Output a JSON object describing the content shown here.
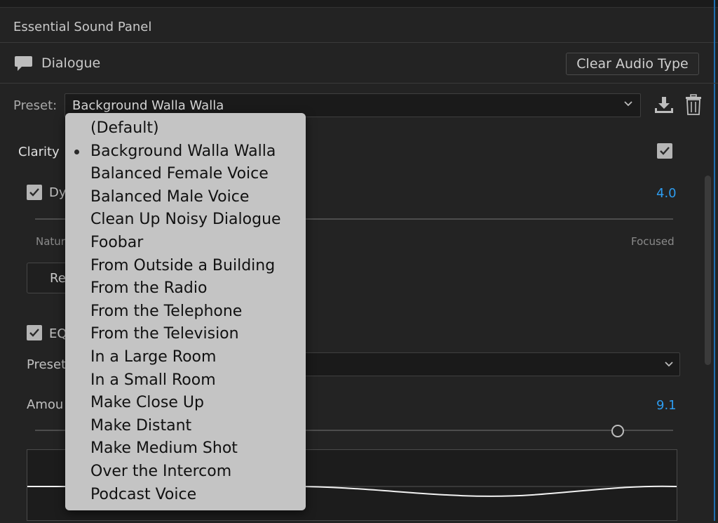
{
  "panel": {
    "title": "Essential Sound Panel"
  },
  "audio_type": {
    "label": "Dialogue",
    "clear_button": "Clear Audio Type",
    "icon": "speech-bubble-icon"
  },
  "preset": {
    "label": "Preset:",
    "selected": "Background Walla Walla"
  },
  "clarity": {
    "label": "Clarity",
    "enabled": true
  },
  "dynamics": {
    "label_partial": "Dy",
    "checked": true,
    "value": "4.0",
    "left_label_partial": "Natur",
    "right_label": "Focused",
    "reset_partial": "Re"
  },
  "eq": {
    "label_partial": "EQ",
    "checked": true,
    "preset_label_partial": "Preset",
    "amount_label_partial": "Amou",
    "amount_value": "9.1",
    "amount_fraction": 0.91
  },
  "dropdown": {
    "items": [
      {
        "label": "(Default)",
        "selected": false
      },
      {
        "label": "Background Walla Walla",
        "selected": true
      },
      {
        "label": "Balanced Female Voice",
        "selected": false
      },
      {
        "label": "Balanced Male Voice",
        "selected": false
      },
      {
        "label": "Clean Up Noisy Dialogue",
        "selected": false
      },
      {
        "label": "Foobar",
        "selected": false
      },
      {
        "label": "From Outside a Building",
        "selected": false
      },
      {
        "label": "From the Radio",
        "selected": false
      },
      {
        "label": "From the Telephone",
        "selected": false
      },
      {
        "label": "From the Television",
        "selected": false
      },
      {
        "label": "In a Large Room",
        "selected": false
      },
      {
        "label": "In a Small Room",
        "selected": false
      },
      {
        "label": "Make Close Up",
        "selected": false
      },
      {
        "label": "Make Distant",
        "selected": false
      },
      {
        "label": "Make Medium Shot",
        "selected": false
      },
      {
        "label": "Over the Intercom",
        "selected": false
      },
      {
        "label": "Podcast Voice",
        "selected": false
      }
    ]
  },
  "colors": {
    "background": "#232323",
    "accent_blue": "#2d9cf0",
    "dropdown_bg": "#c4c4c4"
  }
}
